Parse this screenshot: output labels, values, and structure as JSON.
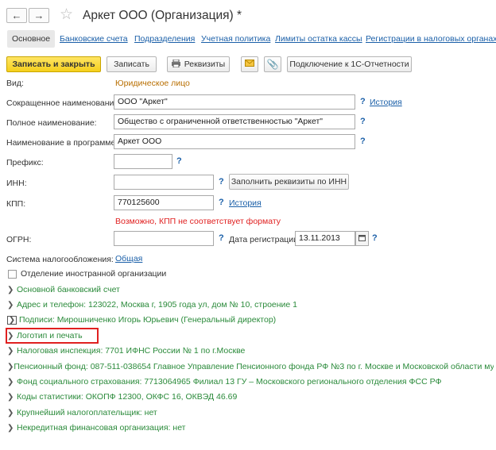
{
  "window": {
    "title": "Аркет ООО (Организация) *"
  },
  "tabs": [
    "Основное",
    "Банковские счета",
    "Подразделения",
    "Учетная политика",
    "Лимиты остатка кассы",
    "Регистрации в налоговых органах"
  ],
  "toolbar": {
    "save_close": "Записать и закрыть",
    "save": "Записать",
    "requisites": "Реквизиты",
    "connect": "Подключение к 1С-Отчетности"
  },
  "form": {
    "vid_label": "Вид:",
    "vid_value": "Юридическое лицо",
    "short_name_label": "Сокращенное наименование:",
    "short_name_value": "ООО \"Аркет\"",
    "full_name_label": "Полное наименование:",
    "full_name_value": "Общество с ограниченной ответственностью \"Аркет\"",
    "program_name_label": "Наименование в программе:",
    "program_name_value": "Аркет ООО",
    "prefix_label": "Префикс:",
    "prefix_value": "",
    "inn_label": "ИНН:",
    "inn_value": "",
    "fill_by_inn": "Заполнить реквизиты по ИНН",
    "kpp_label": "КПП:",
    "kpp_value": "770125600",
    "kpp_error": "Возможно, КПП не соответствует формату",
    "ogrn_label": "ОГРН:",
    "ogrn_value": "",
    "reg_date_label": "Дата регистрации:",
    "reg_date_value": "13.11.2013",
    "tax_system_label": "Система налогообложения:",
    "tax_system_value": "Общая",
    "foreign_branch_label": "Отделение иностранной организации",
    "foreign_branch_checked": false,
    "history": "История",
    "help": "?"
  },
  "groups": [
    "Основной банковский счет",
    "Адрес и телефон: 123022, Москва г, 1905 года ул, дом № 10, строение 1",
    "Подписи: Мирошниченко Игорь Юрьевич (Генеральный директор)",
    "Логотип и печать",
    "Налоговая инспекция: 7701 ИФНС России № 1 по г.Москве",
    "Пенсионный фонд: 087-511-038654 Главное Управление Пенсионного фонда РФ №3 по г. Москве и Московской области муниципаль",
    "Фонд социального страхования: 7713064965 Филиал 13 ГУ – Московского регионального отделения ФСС РФ",
    "Коды статистики: ОКОПФ 12300, ОКФС 16, ОКВЭД 46.69",
    "Крупнейший налогоплательщик: нет",
    "Некредитная финансовая организация: нет"
  ],
  "colors": {
    "accent": "#f5cf1c",
    "link": "#1a5fa8",
    "group": "#2a8a3a",
    "error": "#e02020",
    "highlight": "#e02020"
  }
}
